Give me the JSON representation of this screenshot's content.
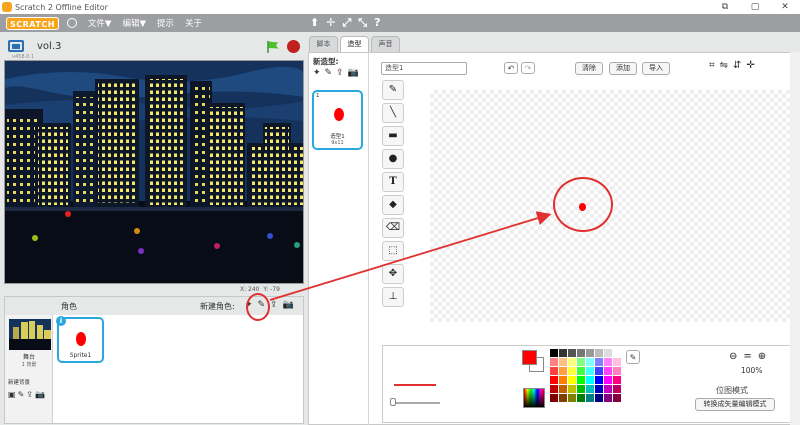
{
  "window": {
    "title": "Scratch 2 Offline Editor",
    "controls": [
      "⧉",
      "▢",
      "✕"
    ]
  },
  "menubar": {
    "logo": "SCRATCH",
    "file": "文件▼",
    "edit": "编辑▼",
    "tips": "提示",
    "about": "关于",
    "tools": [
      "⬆",
      "✛",
      "⤢",
      "⤡",
      "?"
    ]
  },
  "stage": {
    "project_name": "vol.3",
    "version": "v458.0.1",
    "coord_x": "X: 240",
    "coord_y": "Y: -79"
  },
  "sprites": {
    "header_label": "角色",
    "new_sprite_label": "新建角色:",
    "stage_label": "舞台",
    "backdrop_count": "1 背景",
    "new_backdrop_label": "新建背景",
    "items": [
      {
        "name": "Sprite1"
      }
    ]
  },
  "tabs": [
    {
      "label": "脚本"
    },
    {
      "label": "造型"
    },
    {
      "label": "声音"
    }
  ],
  "costumes": {
    "new_costume_label": "新造型:",
    "items": [
      {
        "index": "1",
        "name": "造型1",
        "size": "9x11"
      }
    ]
  },
  "editor": {
    "costume_name": "造型1",
    "clear": "清除",
    "add": "添加",
    "import": "导入",
    "zoom": "100%",
    "mode": "位图模式",
    "convert": "转换成矢量编辑模式",
    "selected_color": "#ff0000",
    "palette": [
      "#000000",
      "#333333",
      "#555555",
      "#777777",
      "#999999",
      "#bbbbbb",
      "#dddddd",
      "#ffffff",
      "#ff8080",
      "#ffbf80",
      "#ffff80",
      "#80ff80",
      "#80ffff",
      "#8080ff",
      "#ff80ff",
      "#ffc0e0",
      "#ff4040",
      "#ff9f40",
      "#ffff40",
      "#40ff40",
      "#40ffff",
      "#4040ff",
      "#ff40ff",
      "#ff80c0",
      "#ff0000",
      "#ff8000",
      "#ffff00",
      "#00ff00",
      "#00ffff",
      "#0000ff",
      "#ff00ff",
      "#ff0080",
      "#c00000",
      "#c06000",
      "#c0c000",
      "#00c000",
      "#00c0c0",
      "#0000c0",
      "#c000c0",
      "#c00060",
      "#800000",
      "#804000",
      "#808000",
      "#008000",
      "#008080",
      "#000080",
      "#800080",
      "#800040"
    ]
  }
}
